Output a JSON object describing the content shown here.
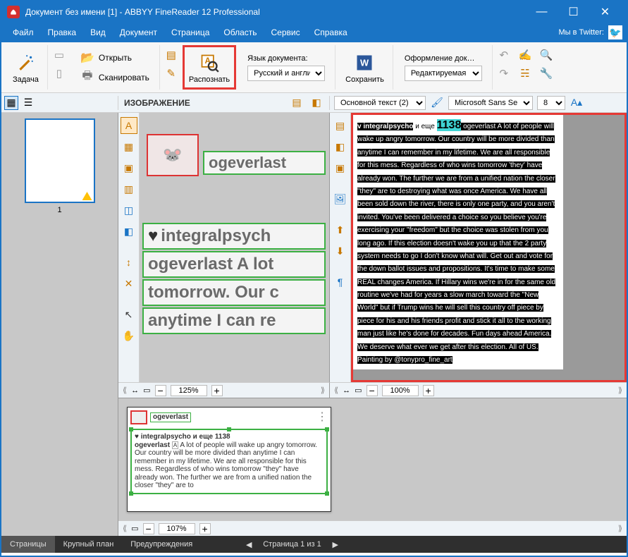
{
  "titlebar": {
    "app_title": "Документ без имени [1] - ABBYY FineReader 12 Professional"
  },
  "menu": {
    "items": [
      "Файл",
      "Правка",
      "Вид",
      "Документ",
      "Страница",
      "Область",
      "Сервис",
      "Справка"
    ],
    "twitter": "Мы в Twitter:"
  },
  "ribbon": {
    "task": "Задача",
    "open": "Открыть",
    "scan": "Сканировать",
    "recognize": "Распознать",
    "lang_label": "Язык документа:",
    "lang_value": "Русский и англий",
    "save": "Сохранить",
    "layout_label": "Оформление док…",
    "layout_value": "Редактируемая"
  },
  "sec": {
    "image_label": "ИЗОБРАЖЕНИЕ",
    "style": "Основной текст (2)",
    "font": "Microsoft Sans Serif",
    "fontsize": "8"
  },
  "pages_panel": {
    "page_num": "1"
  },
  "image_zoom": "125%",
  "text_zoom": "100%",
  "thumb_zoom": "107%",
  "image_view": {
    "frag1": "ogeverlast",
    "frag2": "integralpsych",
    "frag3": "ogeverlast A lot",
    "frag4": "tomorrow. Our c",
    "frag5": "anytime I can re"
  },
  "text_view": {
    "line_user": "v integralpsycho",
    "line_and": " и еще ",
    "line_num": "1138",
    "line_ogever": " ogeverlast ",
    "body": "A lot of people will wake up angry tomorrow. Our country will be more divided than anytime I can remember in my lifetime. We are all responsible for this mess. Regardless of who wins tomorrow 'they' have already won. The further we are from a unified nation the closer \"they\" are to destroying what was once America. We have all been sold down the river, there is only one party, and you aren't invited. You've been delivered a choice so you believe you're exercising your \"freedom\" but the choice was stolen from you long ago. If this election doesn't wake you up that the 2 party system needs to go I don't know what will. Get out and vote for the down ballot issues and propositions. It's time to make some REAL changes America. If Hillary wins we're in for the same old routine we've had for years a slow march toward the \"New World\" but if Trump wins he will sell this country off piece by piece for his and his friends profit and stick it all to the working man just like he's done for decades. Fun days ahead America. We deserve what ever we get after this election. All of US. Painting by @tonypro_fine_art"
  },
  "thumb_view": {
    "username": "ogeverlast",
    "heart_row": "♥ integralpsycho и еще 1138",
    "lead": "ogeverlast",
    "body": "A lot of people will wake up angry tomorrow. Our country will be more divided than anytime I can remember in my lifetime. We are all responsible for this mess. Regardless of who wins tomorrow \"they\" have already won. The further we are from a unified nation the closer \"they\" are to"
  },
  "status": {
    "tab1": "Страницы",
    "tab2": "Крупный план",
    "tab3": "Предупреждения",
    "page_of": "Страница 1 из 1"
  }
}
